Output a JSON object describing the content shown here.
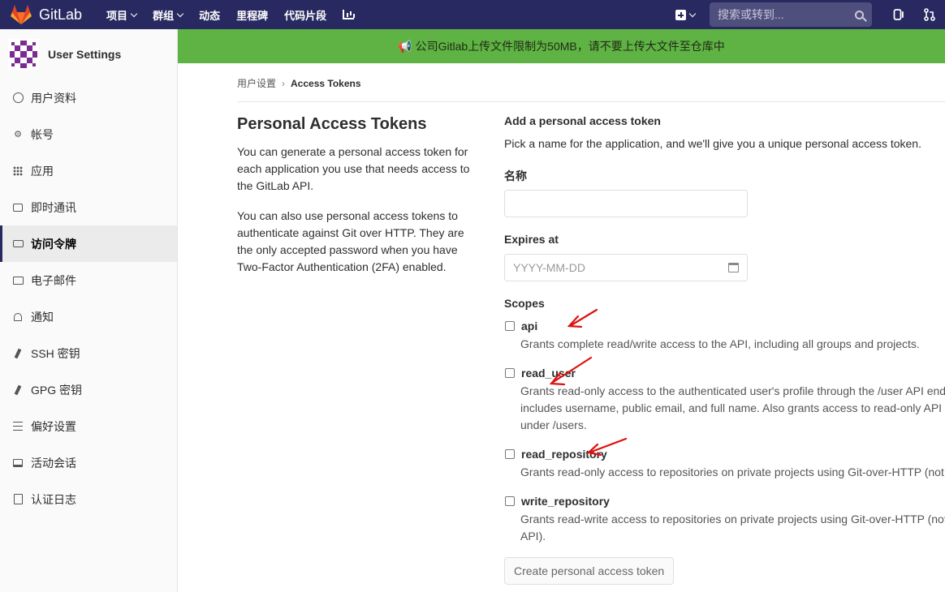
{
  "navbar": {
    "brand": "GitLab",
    "links": [
      {
        "label": "项目",
        "dropdown": true
      },
      {
        "label": "群组",
        "dropdown": true
      },
      {
        "label": "动态",
        "dropdown": false
      },
      {
        "label": "里程碑",
        "dropdown": false
      },
      {
        "label": "代码片段",
        "dropdown": false
      }
    ],
    "search_placeholder": "搜索或转到..."
  },
  "sidebar": {
    "title": "User Settings",
    "items": [
      {
        "label": "用户资料",
        "icon": "profile-icon"
      },
      {
        "label": "帐号",
        "icon": "account-icon"
      },
      {
        "label": "应用",
        "icon": "applications-icon"
      },
      {
        "label": "即时通讯",
        "icon": "chat-icon"
      },
      {
        "label": "访问令牌",
        "icon": "token-icon",
        "active": true
      },
      {
        "label": "电子邮件",
        "icon": "email-icon"
      },
      {
        "label": "通知",
        "icon": "bell-icon"
      },
      {
        "label": "SSH 密钥",
        "icon": "key-icon"
      },
      {
        "label": "GPG 密钥",
        "icon": "key-icon"
      },
      {
        "label": "偏好设置",
        "icon": "preferences-icon"
      },
      {
        "label": "活动会话",
        "icon": "sessions-icon"
      },
      {
        "label": "认证日志",
        "icon": "log-icon"
      }
    ]
  },
  "banner": {
    "text": "📢 公司Gitlab上传文件限制为50MB，请不要上传大文件至仓库中",
    "color": "#5fb344"
  },
  "breadcrumb": {
    "parent": "用户设置",
    "separator": "›",
    "current": "Access Tokens"
  },
  "left": {
    "title": "Personal Access Tokens",
    "para1": "You can generate a personal access token for each application you use that needs access to the GitLab API.",
    "para2": "You can also use personal access tokens to authenticate against Git over HTTP. They are the only accepted password when you have Two-Factor Authentication (2FA) enabled."
  },
  "form": {
    "title": "Add a personal access token",
    "subtitle": "Pick a name for the application, and we'll give you a unique personal access token.",
    "name_label": "名称",
    "name_value": "",
    "expires_label": "Expires at",
    "expires_placeholder": "YYYY-MM-DD",
    "scopes_label": "Scopes",
    "scopes": [
      {
        "name": "api",
        "checked": false,
        "lines": [
          "Grants complete read/write access to the API, including all groups and projects."
        ]
      },
      {
        "name": "read_user",
        "checked": false,
        "lines": [
          "Grants read-only access to the authenticated user's profile through the /user API endp",
          "includes username, public email, and full name. Also grants access to read-only API en",
          "under /users."
        ]
      },
      {
        "name": "read_repository",
        "checked": false,
        "lines": [
          "Grants read-only access to repositories on private projects using Git-over-HTTP (not u"
        ]
      },
      {
        "name": "write_repository",
        "checked": false,
        "lines": [
          "Grants read-write access to repositories on private projects using Git-over-HTTP (not",
          "API)."
        ]
      }
    ],
    "submit_label": "Create personal access token"
  }
}
